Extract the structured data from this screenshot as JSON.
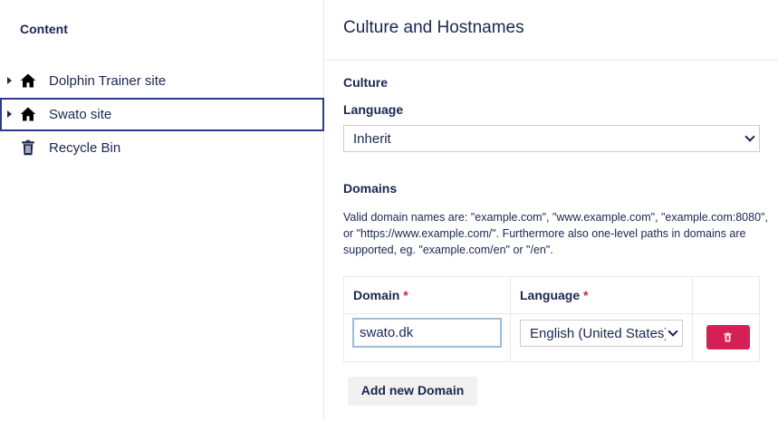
{
  "sidebar": {
    "title": "Content",
    "items": [
      {
        "label": "Dolphin Trainer site",
        "icon": "home-icon",
        "has_children": true,
        "selected": false
      },
      {
        "label": "Swato site",
        "icon": "home-icon",
        "has_children": true,
        "selected": true
      },
      {
        "label": "Recycle Bin",
        "icon": "trash-icon",
        "has_children": false,
        "selected": false
      }
    ]
  },
  "main": {
    "title": "Culture and Hostnames",
    "culture": {
      "heading": "Culture",
      "language_label": "Language",
      "language_value": "Inherit"
    },
    "domains": {
      "heading": "Domains",
      "help": "Valid domain names are: \"example.com\", \"www.example.com\", \"example.com:8080\", or \"https://www.example.com/\". Furthermore also one-level paths in domains are supported, eg. \"example.com/en\" or \"/en\".",
      "col_domain": "Domain",
      "col_language": "Language",
      "required_mark": "*",
      "rows": [
        {
          "domain": "swato.dk",
          "language": "English (United States)"
        }
      ],
      "add_label": "Add new Domain"
    }
  },
  "colors": {
    "text": "#1b264f",
    "danger": "#d42054",
    "selection_outline": "#2e3a8c",
    "input_focus": "#9bbddc"
  }
}
